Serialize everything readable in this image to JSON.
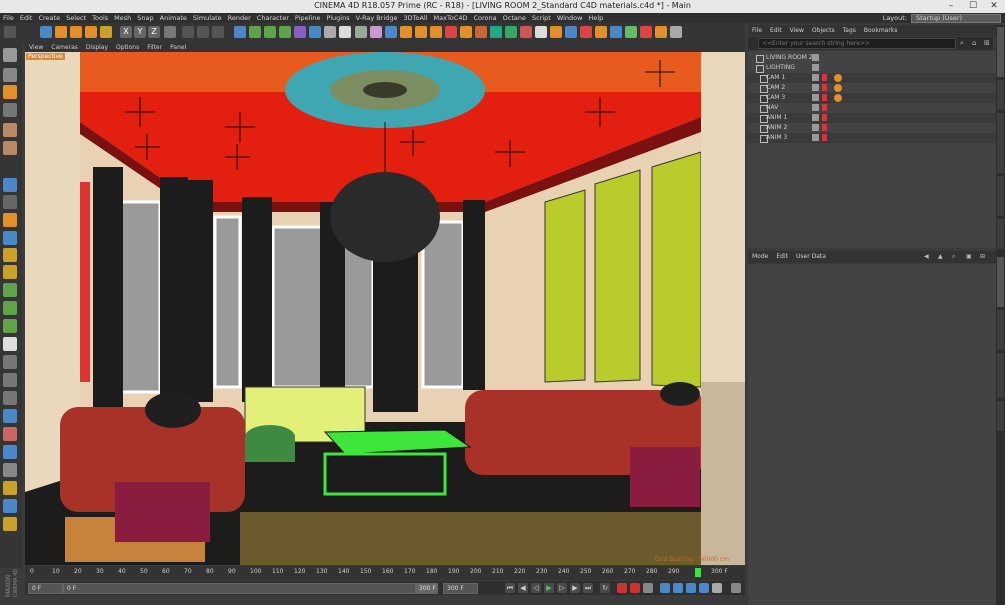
{
  "window": {
    "title": "CINEMA 4D R18.057 Prime (RC - R18) - [LIVING ROOM 2_Standard C4D materials.c4d *] - Main",
    "minimize": "–",
    "maximize": "☐",
    "close": "✕"
  },
  "menubar": {
    "items": [
      "File",
      "Edit",
      "Create",
      "Select",
      "Tools",
      "Mesh",
      "Snap",
      "Animate",
      "Simulate",
      "Render",
      "Character",
      "Pipeline",
      "Plugins",
      "V-Ray Bridge",
      "3DToAll",
      "MaxToC4D",
      "Corona",
      "Octane",
      "Script",
      "Window",
      "Help"
    ],
    "layout_label": "Layout:",
    "layout_value": "Startup (User)"
  },
  "toolbar": {
    "icons": [
      "undo-icon",
      "move-icon",
      "scale-icon",
      "rotate-icon",
      "select-icon",
      "x-axis-icon",
      "y-axis-icon",
      "z-axis-icon",
      "coord-icon",
      "render-view-icon",
      "render-icon",
      "render-settings-icon",
      "cube-icon",
      "pen-icon",
      "subdivision-icon",
      "array-icon",
      "deformer-icon",
      "scene-icon",
      "camera-icon",
      "light-icon"
    ],
    "axis_labels": [
      "X",
      "Y",
      "Z"
    ]
  },
  "viewport": {
    "menu": [
      "View",
      "Cameras",
      "Display",
      "Options",
      "Filter",
      "Panel"
    ],
    "label": "Perspective",
    "grid_spacing": "Grid Spacing : 50000 cm"
  },
  "timeline": {
    "ticks": [
      "0",
      "10",
      "20",
      "30",
      "40",
      "50",
      "60",
      "70",
      "80",
      "90",
      "100",
      "110",
      "120",
      "130",
      "140",
      "150",
      "160",
      "170",
      "180",
      "190",
      "200",
      "210",
      "220",
      "230",
      "240",
      "250",
      "260",
      "270",
      "280",
      "290"
    ],
    "current_frame": "0 F",
    "end_frame": "300 F",
    "start_field": "0 F",
    "min_field": "0 F",
    "max_field": "300 F",
    "max_field2": "300 F",
    "playhead_percent": 0
  },
  "objects": {
    "menu": [
      "File",
      "Edit",
      "View",
      "Objects",
      "Tags",
      "Bookmarks"
    ],
    "search_placeholder": "<<Enter your search string here>>",
    "rows": [
      {
        "name": "LIVING ROOM 2",
        "level": 0,
        "tag": false
      },
      {
        "name": "LIGHTING",
        "level": 0,
        "tag": false
      },
      {
        "name": "CAM 1",
        "level": 1,
        "tag": true
      },
      {
        "name": "CAM 2",
        "level": 1,
        "tag": true
      },
      {
        "name": "CAM 3",
        "level": 1,
        "tag": true
      },
      {
        "name": "NAV",
        "level": 1,
        "tag": false
      },
      {
        "name": "ANIM 1",
        "level": 1,
        "tag": false
      },
      {
        "name": "ANIM 2",
        "level": 1,
        "tag": false
      },
      {
        "name": "ANIM 3",
        "level": 1,
        "tag": false
      }
    ]
  },
  "attributes": {
    "menu": [
      "Mode",
      "Edit",
      "User Data"
    ]
  },
  "side_tabs": [
    "Objects",
    "Takes",
    "Content Browser",
    "Structure",
    "Layers",
    "Attributes",
    "Materials",
    "Coordinates",
    "Layers"
  ],
  "brand": {
    "line1": "MAXON",
    "line2": "CINEMA 4D"
  },
  "colors": {
    "ui_bg": "#3b3b3b",
    "panel": "#434343",
    "accent_blue": "#4a88c8",
    "tag_orange": "#e3902b",
    "ceiling": "#e3200f",
    "wall": "#e9d2b4",
    "art": "#b9cc2c"
  }
}
